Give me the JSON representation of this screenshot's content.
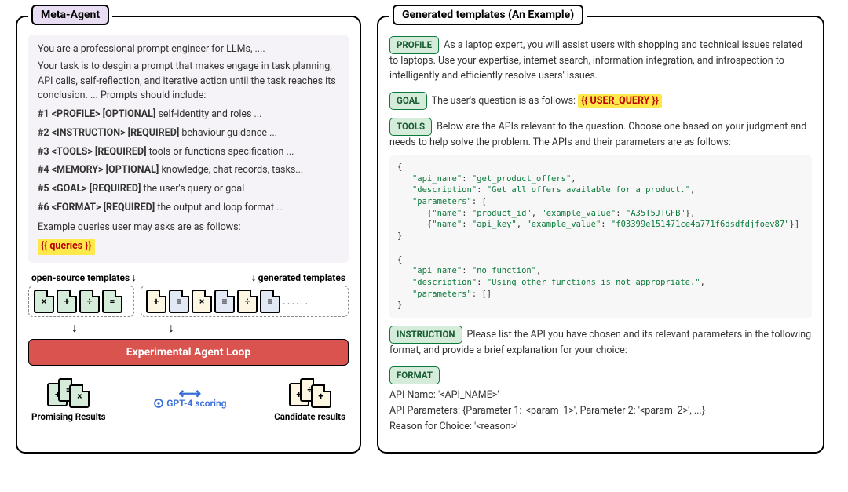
{
  "left": {
    "title": "Meta-Agent",
    "intro1": "You are a professional prompt engineer for LLMs, ....",
    "intro2": "Your task is to desgin a prompt that makes engage in task planning, API calls, self-reflection, and iterative action until the task reaches its conclusion. ... Prompts should include:",
    "items": [
      {
        "num": "#1",
        "tag": "<PROFILE>",
        "req": "[OPTIONAL]",
        "desc": "self-identity and roles ..."
      },
      {
        "num": "#2",
        "tag": "<INSTRUCTION>",
        "req": "[REQUIRED]",
        "desc": "behaviour guidance ..."
      },
      {
        "num": "#3",
        "tag": "<TOOLS>",
        "req": "[REQUIRED]",
        "desc": "tools or functions specification ..."
      },
      {
        "num": "#4",
        "tag": "<MEMORY>",
        "req": "[OPTIONAL]",
        "desc": "knowledge, chat records, tasks..."
      },
      {
        "num": "#5",
        "tag": "<GOAL>",
        "req": "[REQUIRED]",
        "desc": "the user's query or goal"
      },
      {
        "num": "#6",
        "tag": "<FORMAT>",
        "req": "[REQUIRED]",
        "desc": "the output and loop format ..."
      }
    ],
    "example_label": "Example queries user may asks are as follows:",
    "queries_placeholder": "{{ queries }}",
    "tpl_label_left": "open-source templates",
    "tpl_label_right": "generated templates",
    "loop_label": "Experimental Agent Loop",
    "promising_label": "Promising Results",
    "candidate_label": "Candidate results",
    "scoring_label": "GPT-4 scoring",
    "doc_glyphs_left": [
      "×",
      "+",
      "÷",
      "="
    ],
    "doc_glyphs_right": [
      "+",
      "≡",
      "×",
      "≡",
      "÷",
      "≡"
    ]
  },
  "right": {
    "title": "Generated templates (An Example)",
    "profile_chip": "PROFILE",
    "profile_text": "As a laptop expert, you will assist users with shopping and technical issues related to laptops. Use your expertise, internet search, information integration, and introspection to intelligently and efficiently resolve users' issues.",
    "goal_chip": "GOAL",
    "goal_text": "The user's question is as follows:",
    "goal_placeholder": "{{ USER_QUERY }}",
    "tools_chip": "TOOLS",
    "tools_text": "Below are the APIs relevant to the question. Choose one based on your judgment and needs to help solve the problem. The APIs and their parameters are as follows:",
    "api1": {
      "name": "get_product_offers",
      "description": "Get all offers available for a product.",
      "params": [
        {
          "name": "product_id",
          "example": "A35T5JTGFB"
        },
        {
          "name": "api_key",
          "example": "f03399e151471ce4a771f6dsdfdjfoev87"
        }
      ]
    },
    "api2": {
      "name": "no_function",
      "description": "Using other functions is not appropriate.",
      "params_display": "[]"
    },
    "instruction_chip": "INSTRUCTION",
    "instruction_text": "Please list the API you have chosen and its relevant parameters in the following format, and provide a brief explanation for your choice:",
    "format_chip": "FORMAT",
    "format_lines": [
      "API Name: '<API_NAME>'",
      "API Parameters: {Parameter 1: '<param_1>', Parameter 2: '<param_2>', ...}",
      "Reason for Choice: '<reason>'"
    ]
  }
}
